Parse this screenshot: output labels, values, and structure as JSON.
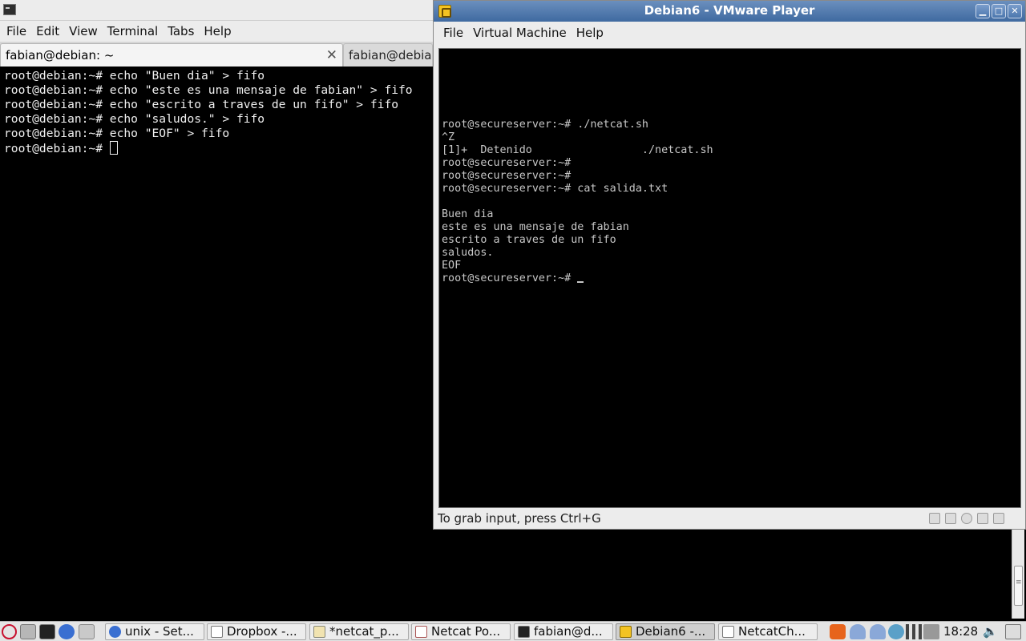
{
  "terminal": {
    "menu": [
      "File",
      "Edit",
      "View",
      "Terminal",
      "Tabs",
      "Help"
    ],
    "tabs": [
      {
        "label": "fabian@debian: ~"
      },
      {
        "label": "fabian@debian: ~"
      }
    ],
    "tab_close": "✕",
    "lines": [
      "root@debian:~# echo \"Buen dia\" > fifo",
      "root@debian:~# echo \"este es una mensaje de fabian\" > fifo",
      "root@debian:~# echo \"escrito a traves de un fifo\" > fifo",
      "root@debian:~# echo \"saludos.\" > fifo",
      "root@debian:~# echo \"EOF\" > fifo"
    ],
    "prompt": "root@debian:~# "
  },
  "vmware": {
    "title": "Debian6 - VMware Player",
    "menu": [
      "File",
      "Virtual Machine",
      "Help"
    ],
    "console_lines": [
      "root@secureserver:~# ./netcat.sh",
      "^Z",
      "[1]+  Detenido                 ./netcat.sh",
      "root@secureserver:~#",
      "root@secureserver:~#",
      "root@secureserver:~# cat salida.txt",
      "",
      "Buen dia",
      "este es una mensaje de fabian",
      "escrito a traves de un fifo",
      "saludos.",
      "EOF"
    ],
    "console_prompt": "root@secureserver:~# ",
    "status_hint": "To grab input, press Ctrl+G"
  },
  "taskbar": {
    "tasks": [
      {
        "label": "unix - Set..."
      },
      {
        "label": "Dropbox -..."
      },
      {
        "label": "*netcat_p..."
      },
      {
        "label": "Netcat Po..."
      },
      {
        "label": "fabian@d..."
      },
      {
        "label": "Debian6 -..."
      },
      {
        "label": "NetcatCh..."
      }
    ],
    "clock": "18:28"
  }
}
